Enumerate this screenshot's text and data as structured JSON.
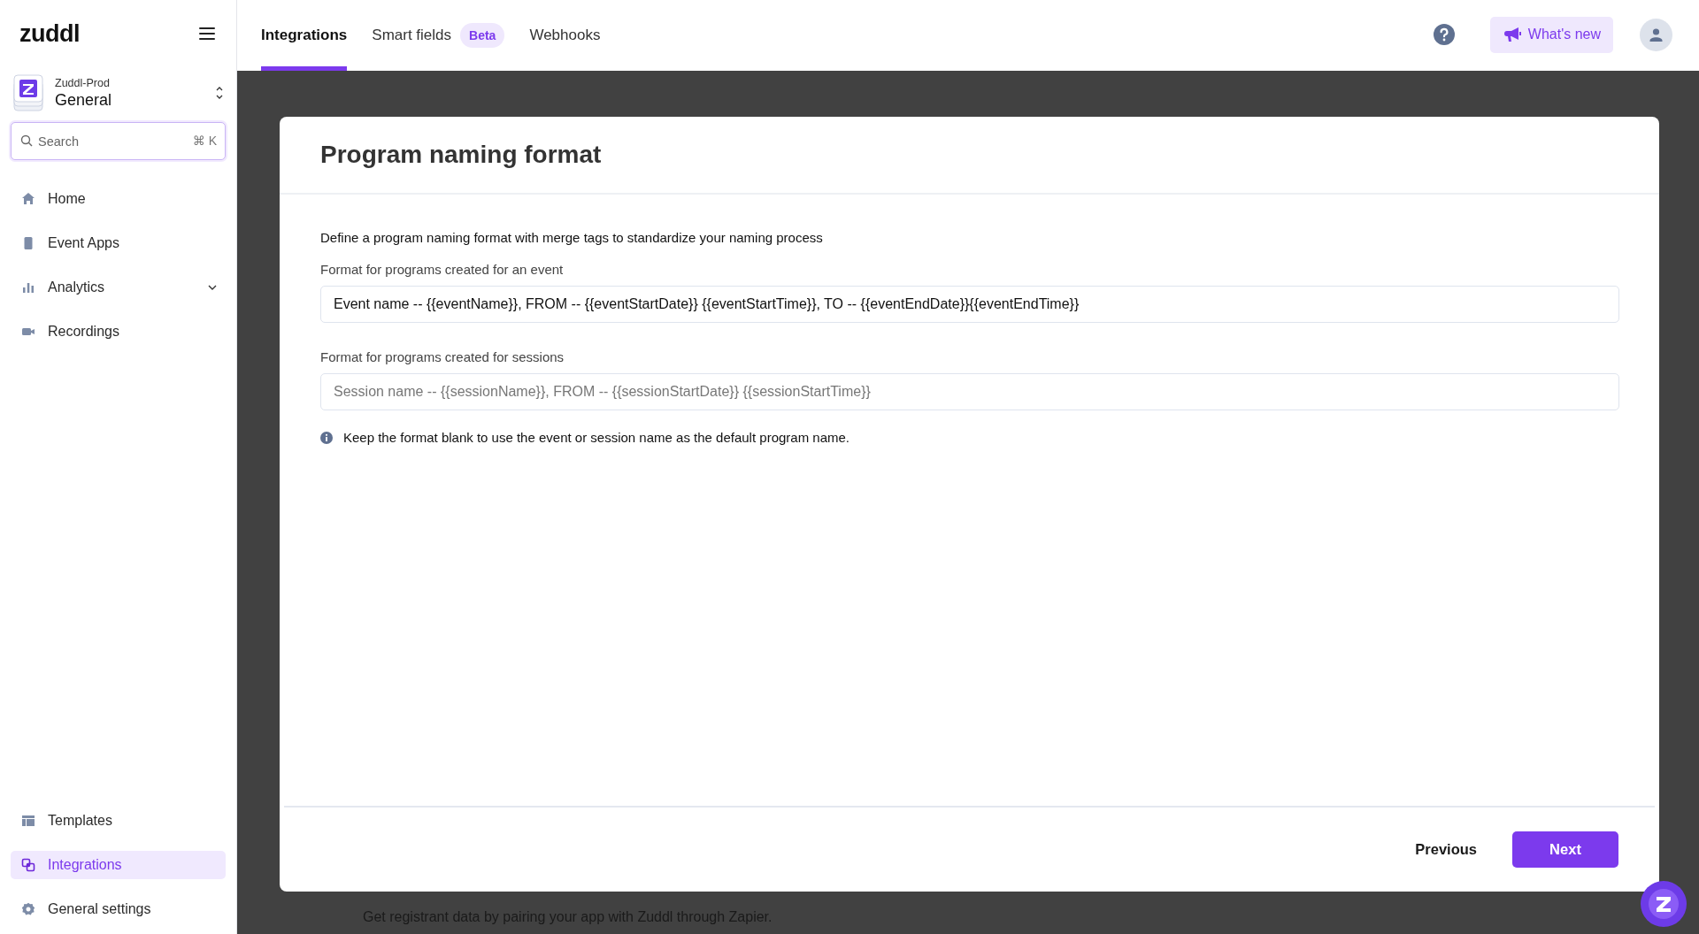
{
  "sidebar": {
    "logo": "zuddl",
    "workspace": {
      "org": "Zuddl-Prod",
      "name": "General"
    },
    "search": {
      "placeholder": "Search",
      "shortcut": "⌘ K"
    },
    "nav_top": [
      {
        "label": "Home",
        "expandable": false,
        "selected": false
      },
      {
        "label": "Event Apps",
        "expandable": false,
        "selected": false
      },
      {
        "label": "Analytics",
        "expandable": true,
        "selected": false
      },
      {
        "label": "Recordings",
        "expandable": false,
        "selected": false
      }
    ],
    "nav_bottom": [
      {
        "label": "Templates",
        "expandable": false,
        "selected": false
      },
      {
        "label": "Integrations",
        "expandable": false,
        "selected": true
      },
      {
        "label": "General settings",
        "expandable": false,
        "selected": false
      }
    ]
  },
  "tabs": [
    {
      "label": "Integrations",
      "selected": true
    },
    {
      "label": "Smart fields",
      "badge": "Beta",
      "selected": false
    },
    {
      "label": "Webhooks",
      "selected": false
    }
  ],
  "header": {
    "whats_new": "What's new"
  },
  "background_text": "Get registrant data by pairing your app with Zuddl through Zapier.",
  "modal": {
    "title": "Program naming format",
    "description": "Define a program naming format with merge tags to standardize your naming process",
    "fields": [
      {
        "label": "Format for programs created for an event",
        "value": "Event name -- {{eventName}}, FROM -- {{eventStartDate}} {{eventStartTime}}, TO -- {{eventEndDate}}{{eventEndTime}}"
      },
      {
        "label": "Format for programs created for sessions",
        "placeholder": "Session name -- {{sessionName}}, FROM -- {{sessionStartDate}} {{sessionStartTime}}"
      }
    ],
    "note": "Keep the format blank to use the event or session name as the default program name.",
    "buttons": [
      {
        "label": "Previous",
        "kind": "secondary"
      },
      {
        "label": "Next",
        "kind": "primary"
      }
    ]
  }
}
